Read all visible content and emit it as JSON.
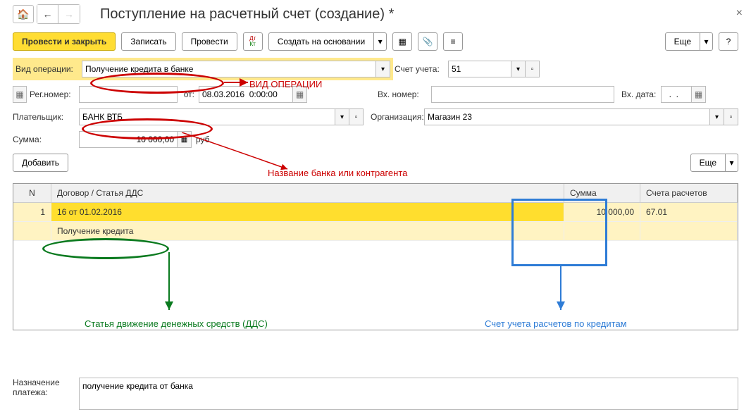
{
  "header": {
    "title": "Поступление на расчетный счет (создание) *"
  },
  "cmdbar": {
    "post_close": "Провести и закрыть",
    "write": "Записать",
    "post": "Провести",
    "create_based": "Создать на основании",
    "more": "Еще"
  },
  "form": {
    "op_type_label": "Вид операции:",
    "op_type_value": "Получение кредита в банке",
    "reg_num_label": "Рег.номер:",
    "reg_num_value": "",
    "from_label": "от:",
    "date_value": "08.03.2016  0:00:00",
    "account_label": "Счет учета:",
    "account_value": "51",
    "in_num_label": "Вх. номер:",
    "in_num_value": "",
    "in_date_label": "Вх. дата:",
    "in_date_value": "  .  .",
    "payer_label": "Плательщик:",
    "payer_value": "БАНК ВТБ",
    "org_label": "Организация:",
    "org_value": "Магазин 23",
    "sum_label": "Сумма:",
    "sum_value": "10 000,00",
    "sum_currency": "руб.",
    "add": "Добавить"
  },
  "table": {
    "col_n": "N",
    "col_dog": "Договор / Статья ДДС",
    "col_sum": "Сумма",
    "col_acc": "Счета расчетов",
    "rows": [
      {
        "n": "1",
        "dog": "16 от 01.02.2016",
        "dds": "Получение кредита",
        "sum": "10 000,00",
        "acc": "67.01"
      }
    ]
  },
  "purpose": {
    "label": "Назначение платежа:",
    "value": "получение кредита от банка"
  },
  "annotations": {
    "op_type": "ВИД ОПЕРАЦИИ",
    "bank_name": "Название банка или контрагента",
    "dds": "Статья движение денежных средств (ДДС)",
    "acc": "Счет учета расчетов по кредитам"
  }
}
